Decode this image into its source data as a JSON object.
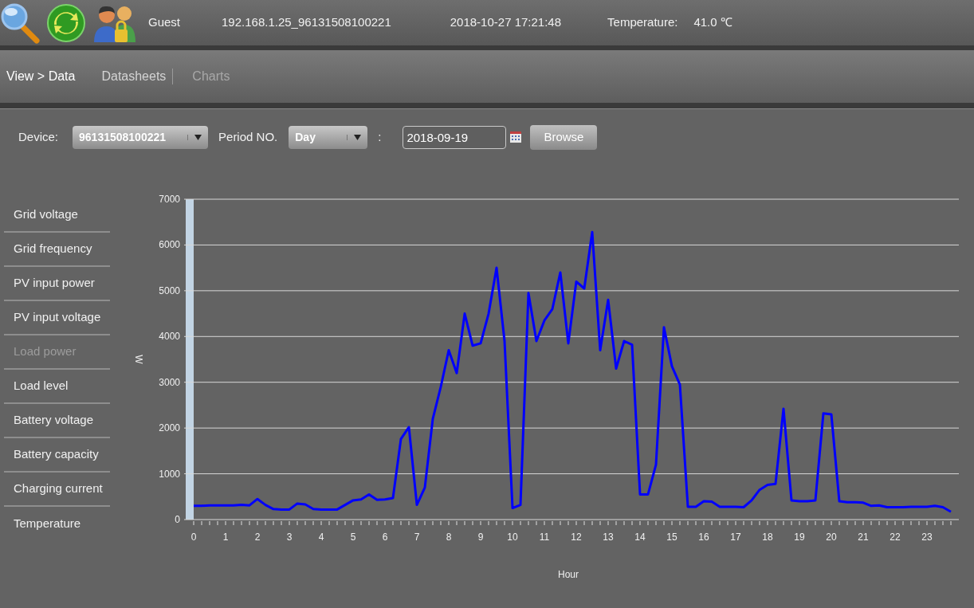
{
  "header": {
    "user": "Guest",
    "device_id": "192.168.1.25_96131508100221",
    "datetime": "2018-10-27 17:21:48",
    "temperature_label": "Temperature:",
    "temperature_value": "41.0 ℃"
  },
  "nav": {
    "breadcrumb": "View > Data",
    "tabs": [
      {
        "label": "Datasheets",
        "selected": false
      },
      {
        "label": "Charts",
        "selected": true
      }
    ]
  },
  "filters": {
    "device_label": "Device:",
    "device_value": "96131508100221",
    "period_label": "Period NO.",
    "period_value": "Day",
    "separator": ":",
    "date_value": "2018-09-19",
    "browse_label": "Browse"
  },
  "sidebar": {
    "items": [
      {
        "label": "Grid voltage",
        "selected": false
      },
      {
        "label": "Grid frequency",
        "selected": false
      },
      {
        "label": "PV input power",
        "selected": false
      },
      {
        "label": "PV input voltage",
        "selected": false
      },
      {
        "label": "Load power",
        "selected": true
      },
      {
        "label": "Load level",
        "selected": false
      },
      {
        "label": "Battery voltage",
        "selected": false
      },
      {
        "label": "Battery capacity",
        "selected": false
      },
      {
        "label": "Charging current",
        "selected": false
      },
      {
        "label": "Temperature",
        "selected": false
      }
    ]
  },
  "chart": {
    "chart_data": {
      "type": "line",
      "xlabel": "Hour",
      "ylabel": "W",
      "x": [
        0,
        0.25,
        0.5,
        0.75,
        1,
        1.25,
        1.5,
        1.75,
        2,
        2.25,
        2.5,
        2.75,
        3,
        3.25,
        3.5,
        3.75,
        4,
        4.25,
        4.5,
        4.75,
        5,
        5.25,
        5.5,
        5.75,
        6,
        6.25,
        6.5,
        6.75,
        7,
        7.25,
        7.5,
        7.75,
        8,
        8.25,
        8.5,
        8.75,
        9,
        9.25,
        9.5,
        9.75,
        10,
        10.25,
        10.5,
        10.75,
        11,
        11.25,
        11.5,
        11.75,
        12,
        12.25,
        12.5,
        12.75,
        13,
        13.25,
        13.5,
        13.75,
        14,
        14.25,
        14.5,
        14.75,
        15,
        15.25,
        15.5,
        15.75,
        16,
        16.25,
        16.5,
        16.75,
        17,
        17.25,
        17.5,
        17.75,
        18,
        18.25,
        18.5,
        18.75,
        19,
        19.25,
        19.5,
        19.75,
        20,
        20.25,
        20.5,
        20.75,
        21,
        21.25,
        21.5,
        21.75,
        22,
        22.25,
        22.5,
        22.75,
        23,
        23.25,
        23.5,
        23.75
      ],
      "series": [
        {
          "color": "#0000ff",
          "values": [
            300,
            300,
            310,
            310,
            310,
            310,
            320,
            310,
            450,
            320,
            230,
            220,
            220,
            350,
            330,
            230,
            220,
            220,
            220,
            320,
            420,
            440,
            550,
            430,
            440,
            470,
            1760,
            2020,
            320,
            700,
            2200,
            2900,
            3700,
            3200,
            4500,
            3800,
            3850,
            4500,
            5500,
            3900,
            250,
            320,
            4950,
            3900,
            4350,
            4600,
            5400,
            3850,
            5200,
            5050,
            6280,
            3700,
            4800,
            3300,
            3900,
            3820,
            550,
            550,
            1200,
            4200,
            3350,
            2950,
            280,
            280,
            400,
            390,
            280,
            280,
            280,
            270,
            420,
            650,
            760,
            780,
            2420,
            420,
            400,
            400,
            420,
            2320,
            2300,
            400,
            380,
            380,
            370,
            300,
            310,
            270,
            270,
            270,
            280,
            280,
            280,
            300,
            270,
            170
          ]
        }
      ],
      "xlim": [
        -0.25,
        24
      ],
      "ylim": [
        0,
        7000
      ],
      "grid": true,
      "bands": [
        {
          "axis": "x",
          "from": -0.25,
          "to": 0,
          "color": "#c2d4e4"
        }
      ],
      "xticks": [
        0,
        1,
        2,
        3,
        4,
        5,
        6,
        7,
        8,
        9,
        10,
        11,
        12,
        13,
        14,
        15,
        16,
        17,
        18,
        19,
        20,
        21,
        22,
        23
      ],
      "yticks": [
        0,
        1000,
        2000,
        3000,
        4000,
        5000,
        6000,
        7000
      ]
    }
  }
}
